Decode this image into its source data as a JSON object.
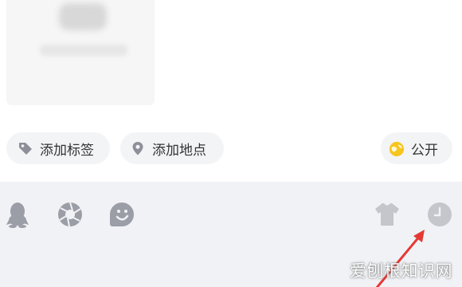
{
  "chips": {
    "tag_label": "添加标签",
    "location_label": "添加地点",
    "visibility_label": "公开"
  },
  "toolbar": {
    "icons": [
      "qq-icon",
      "camera-shutter-icon",
      "emoji-icon",
      "tshirt-icon",
      "clock-icon"
    ]
  },
  "watermark": {
    "text": "爱刨根知识网"
  },
  "colors": {
    "chip_bg": "#f3f4f6",
    "toolbar_bg": "#f1f2f6",
    "icon_gray": "#9b9ea6",
    "icon_light": "#c4c6cc",
    "arrow_red": "#e53935",
    "visibility_yellow": "#f7c51d"
  }
}
